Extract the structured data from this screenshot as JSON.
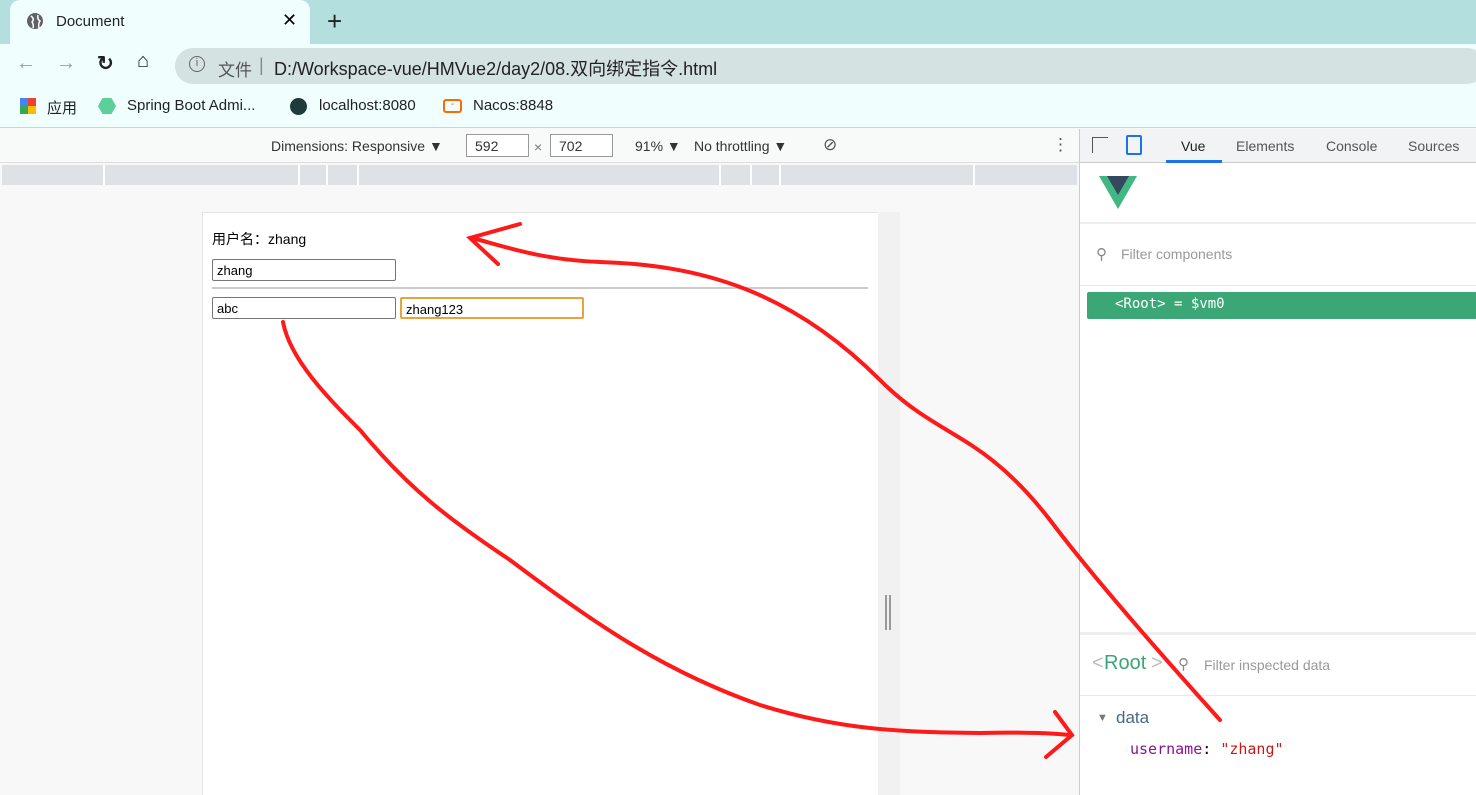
{
  "browser": {
    "tab_title": "Document",
    "url_prefix": "文件",
    "url": "D:/Workspace-vue/HMVue2/day2/08.双向绑定指令.html",
    "bookmarks": [
      {
        "label": "应用",
        "icon": "apps-grid-icon"
      },
      {
        "label": "Spring Boot Admi...",
        "icon": "spring-boot-admin-icon"
      },
      {
        "label": "localhost:8080",
        "icon": "globe-icon"
      },
      {
        "label": "Nacos:8848",
        "icon": "nacos-icon"
      }
    ]
  },
  "device_toolbar": {
    "dimensions": "Dimensions: Responsive ▼",
    "width": "592",
    "height": "702",
    "times": "×",
    "zoom": "91% ▼",
    "throttling": "No throttling ▼"
  },
  "page": {
    "label": "用户名：zhang",
    "input1": "zhang",
    "input2": "abc",
    "input3": "zhang123"
  },
  "devtools": {
    "tabs": [
      "Vue",
      "Elements",
      "Console",
      "Sources"
    ],
    "active_tab": "Vue",
    "filter_components": "Filter components",
    "root_item": {
      "name": "<Root>",
      "suffix": "= $vm0"
    },
    "inspector": {
      "title_lt": "<",
      "title": "Root",
      "title_gt": ">",
      "filter": "Filter inspected data",
      "section": "data",
      "key": "username",
      "colon": ":",
      "value": "\"zhang\""
    }
  },
  "colors": {
    "vue_green": "#3ba776",
    "annotation": "#ff1a1a",
    "focus": "#e8a33d"
  }
}
